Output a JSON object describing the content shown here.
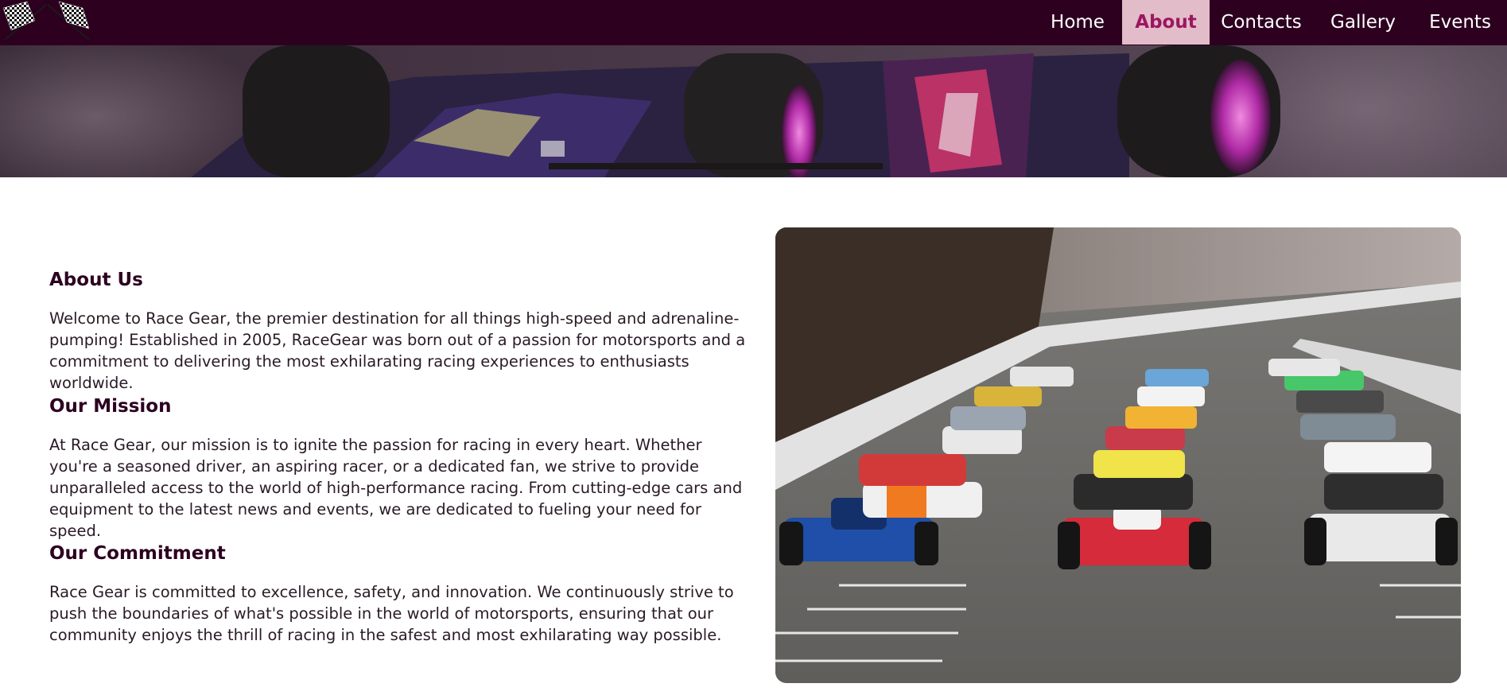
{
  "nav": {
    "items": [
      {
        "label": "Home",
        "active": false
      },
      {
        "label": "About",
        "active": true
      },
      {
        "label": "Contacts",
        "active": false
      },
      {
        "label": "Gallery",
        "active": false
      },
      {
        "label": "Events",
        "active": false
      }
    ]
  },
  "logo": {
    "icon": "checkered-flags-icon"
  },
  "hero": {
    "image": "race-car-closeup-banner"
  },
  "sections": [
    {
      "title": "About Us",
      "text": "Welcome to Race Gear, the premier destination for all things high-speed and adrenaline-pumping! Established in 2005, RaceGear was born out of a passion for motorsports and a commitment to delivering the most exhilarating racing experiences to enthusiasts worldwide."
    },
    {
      "title": "Our Mission",
      "text": "At Race Gear, our mission is to ignite the passion for racing in every heart. Whether you're a seasoned driver, an aspiring racer, or a dedicated fan, we strive to provide unparalleled access to the world of high-performance racing. From cutting-edge cars and equipment to the latest news and events, we are dedicated to fueling your need for speed."
    },
    {
      "title": "Our Commitment",
      "text": "Race Gear is committed to excellence, safety, and innovation. We continuously strive to push the boundaries of what's possible in the world of motorsports, ensuring that our community enjoys the thrill of racing in the safest and most exhilarating way possible."
    }
  ],
  "photo": {
    "image": "indycar-race-start-grid"
  },
  "colors": {
    "nav_background": "#2d0020",
    "active_tab_background": "#e2bcc8",
    "active_tab_text": "#9b1761",
    "heading": "#2d0020"
  }
}
